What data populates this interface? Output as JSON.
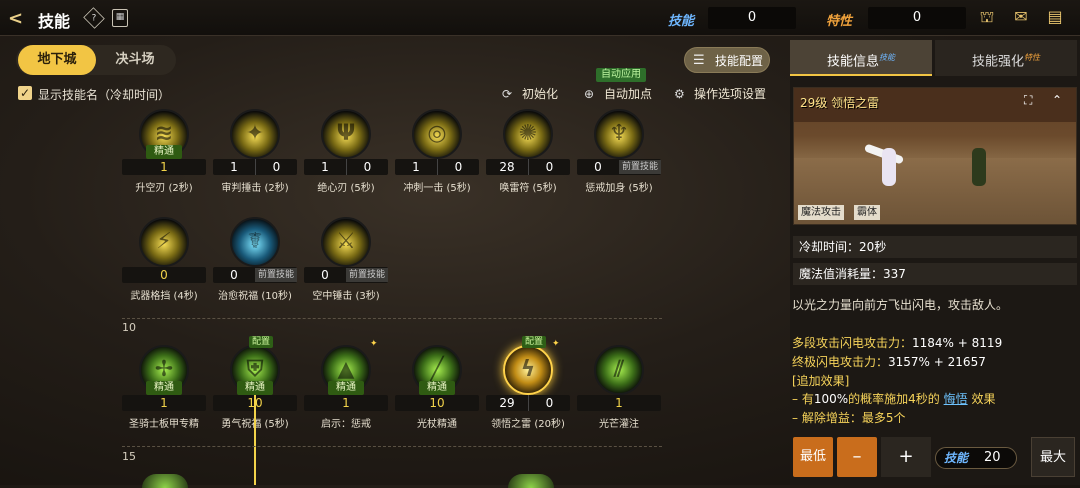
{
  "header": {
    "title": "技能",
    "help_icon": "?",
    "sp_label": "技能",
    "sp_value": "0",
    "tp_label": "特性",
    "tp_value": "0"
  },
  "tabs": [
    {
      "label": "地下城",
      "active": true
    },
    {
      "label": "决斗场",
      "active": false
    }
  ],
  "config_button": "技能配置",
  "toolbar": {
    "show_name_label": "显示技能名（冷却时间）",
    "reset": "初始化",
    "auto_add": "自动加点",
    "auto_badge": "自动应用",
    "settings": "操作选项设置"
  },
  "master_label": "精通",
  "precond_label": "前置技能",
  "config_tag": "配置",
  "level_markers": [
    "10",
    "15"
  ],
  "row1": [
    {
      "name": "升空刃 (2秒)",
      "a": "1",
      "b": "",
      "master": true,
      "style": "gold",
      "glyph": "≋"
    },
    {
      "name": "审判捶击 (2秒)",
      "a": "1",
      "b": "0",
      "master": false,
      "style": "gold",
      "glyph": "✦"
    },
    {
      "name": "绝心刃 (5秒)",
      "a": "1",
      "b": "0",
      "master": false,
      "style": "gold",
      "glyph": "Ψ"
    },
    {
      "name": "冲刺一击 (5秒)",
      "a": "1",
      "b": "0",
      "master": false,
      "style": "gold",
      "glyph": "◎"
    },
    {
      "name": "唤雷符 (5秒)",
      "a": "28",
      "b": "0",
      "master": false,
      "style": "gold",
      "glyph": "✺"
    },
    {
      "name": "惩戒加身 (5秒)",
      "a": "0",
      "b": "",
      "pre": true,
      "master": false,
      "style": "gold",
      "glyph": "♆"
    }
  ],
  "row2": [
    {
      "name": "武器格挡 (4秒)",
      "a": "0",
      "b": "",
      "master": false,
      "style": "gold",
      "glyph": "⚡"
    },
    {
      "name": "治愈祝福 (10秒)",
      "a": "0",
      "b": "",
      "pre": true,
      "master": false,
      "style": "blue",
      "glyph": "☤"
    },
    {
      "name": "空中锤击 (3秒)",
      "a": "0",
      "b": "",
      "pre": true,
      "master": false,
      "style": "gold",
      "glyph": "⚔"
    }
  ],
  "row3": [
    {
      "name": "圣骑士板甲专精",
      "a": "1",
      "b": "",
      "master": true,
      "full": true,
      "style": "green",
      "glyph": "✢"
    },
    {
      "name": "勇气祝福 (5秒)",
      "a": "10",
      "b": "",
      "master": true,
      "full": true,
      "config": true,
      "style": "green",
      "glyph": "⛨"
    },
    {
      "name": "启示：惩戒",
      "a": "1",
      "b": "",
      "master": true,
      "full": true,
      "star": true,
      "style": "green",
      "glyph": "▲"
    },
    {
      "name": "光杖精通",
      "a": "10",
      "b": "",
      "master": true,
      "full": true,
      "style": "green",
      "glyph": "╱"
    },
    {
      "name": "领悟之雷 (20秒)",
      "a": "29",
      "b": "0",
      "master": false,
      "config": true,
      "star": true,
      "style": "fire",
      "glyph": "ϟ"
    },
    {
      "name": "光芒灌注",
      "a": "1",
      "b": "",
      "master": false,
      "full": true,
      "style": "green",
      "glyph": "⫽"
    }
  ],
  "right": {
    "tab_info": "技能信息",
    "tab_info_sup": "技能",
    "tab_enhance": "技能强化",
    "tab_enhance_sup": "特性",
    "preview_title": "29级 领悟之雷",
    "preview_tags": [
      "魔法攻击",
      "霸体"
    ],
    "cooldown": "冷却时间：20秒",
    "mp_cost": "魔法值消耗量：337",
    "desc": "以光之力量向前方飞出闪电，攻击敌人。",
    "stat1_label": "多段攻击闪电攻击力：",
    "stat1_pct": "1184%",
    "stat1_add": "+ 8119",
    "stat2_label": "终极闪电攻击力：",
    "stat2_pct": "3157%",
    "stat2_add": "+ 21657",
    "extra_title": "[追加效果]",
    "extra1_pre": "– 有",
    "extra1_pct": "100%",
    "extra1_mid": "的概率施加4秒的",
    "extra1_link": "悔悟",
    "extra1_post": "效果",
    "extra2": "– 解除增益：最多5个",
    "btn_min": "最低",
    "btn_minus": "–",
    "btn_plus": "+",
    "sp_label": "技能",
    "sp_value": "20",
    "btn_max": "最大"
  },
  "colors": {
    "accent": "#f2c544",
    "green": "#2f5b12",
    "orange": "#c96d1c",
    "sp_blue": "#6fb7ff",
    "tp_orange": "#f0a23c"
  }
}
